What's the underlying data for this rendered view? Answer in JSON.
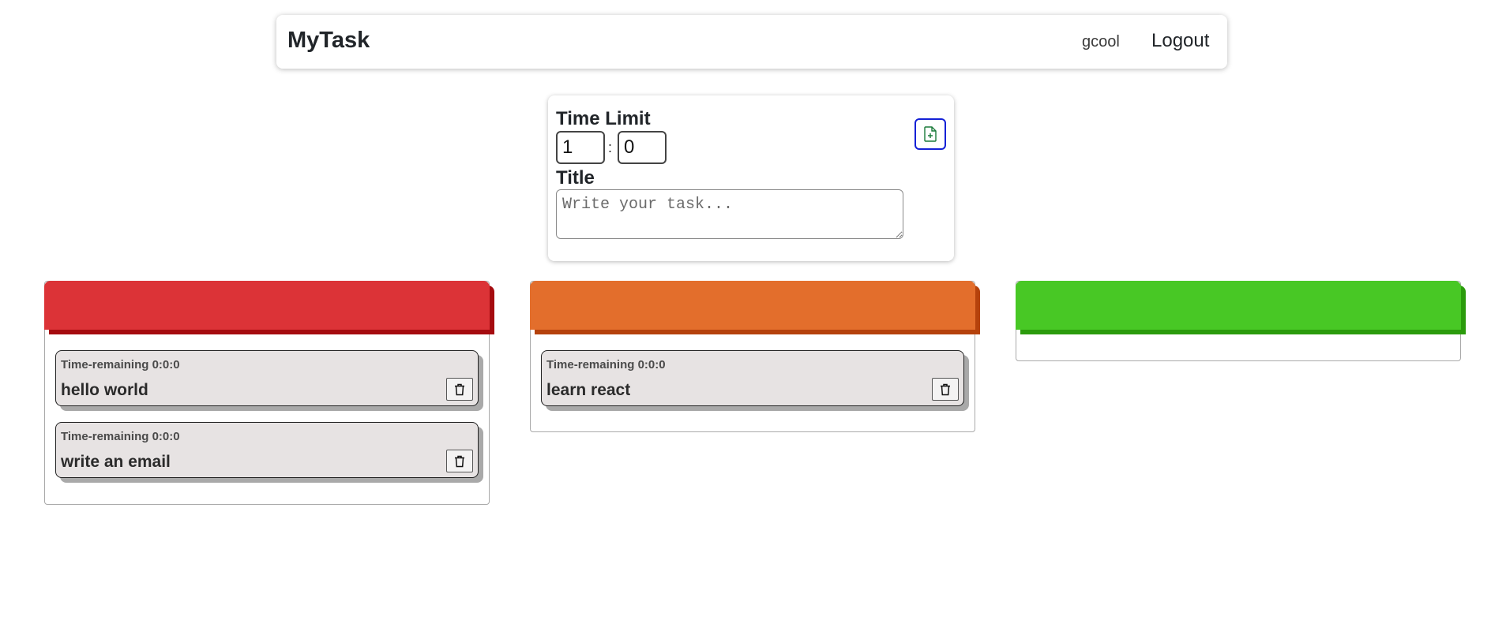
{
  "navbar": {
    "brand": "MyTask",
    "username": "gcool",
    "logout_label": "Logout"
  },
  "form": {
    "time_limit_label": "Time Limit",
    "hours_value": "1",
    "colon": ":",
    "minutes_value": "0",
    "title_label": "Title",
    "title_placeholder": "Write your task...",
    "add_icon": "file-plus-icon"
  },
  "columns": [
    {
      "color": "#dc3337",
      "tasks": [
        {
          "time_remaining": "Time-remaining 0:0:0",
          "title": "hello world"
        },
        {
          "time_remaining": "Time-remaining 0:0:0",
          "title": "write an email"
        }
      ]
    },
    {
      "color": "#e36e2c",
      "tasks": [
        {
          "time_remaining": "Time-remaining 0:0:0",
          "title": "learn react"
        }
      ]
    },
    {
      "color": "#48c825",
      "tasks": []
    }
  ],
  "colors": {
    "add_button_border": "#1421d6",
    "add_icon": "#1a7a3a",
    "task_card_bg": "#e7e3e3"
  }
}
